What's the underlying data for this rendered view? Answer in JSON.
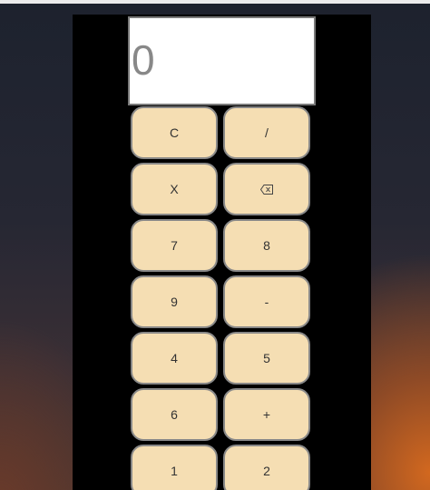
{
  "display": {
    "value": "0"
  },
  "keys": [
    {
      "label": "C"
    },
    {
      "label": "/"
    },
    {
      "label": "X"
    },
    {
      "label": "",
      "icon": "backspace-icon"
    },
    {
      "label": "7"
    },
    {
      "label": "8"
    },
    {
      "label": "9"
    },
    {
      "label": "-"
    },
    {
      "label": "4"
    },
    {
      "label": "5"
    },
    {
      "label": "6"
    },
    {
      "label": "+"
    },
    {
      "label": "1"
    },
    {
      "label": "2"
    }
  ],
  "colors": {
    "panel": "#000000",
    "key_fill": "#f5deb3",
    "key_border": "#888888",
    "display_text": "#888888"
  }
}
